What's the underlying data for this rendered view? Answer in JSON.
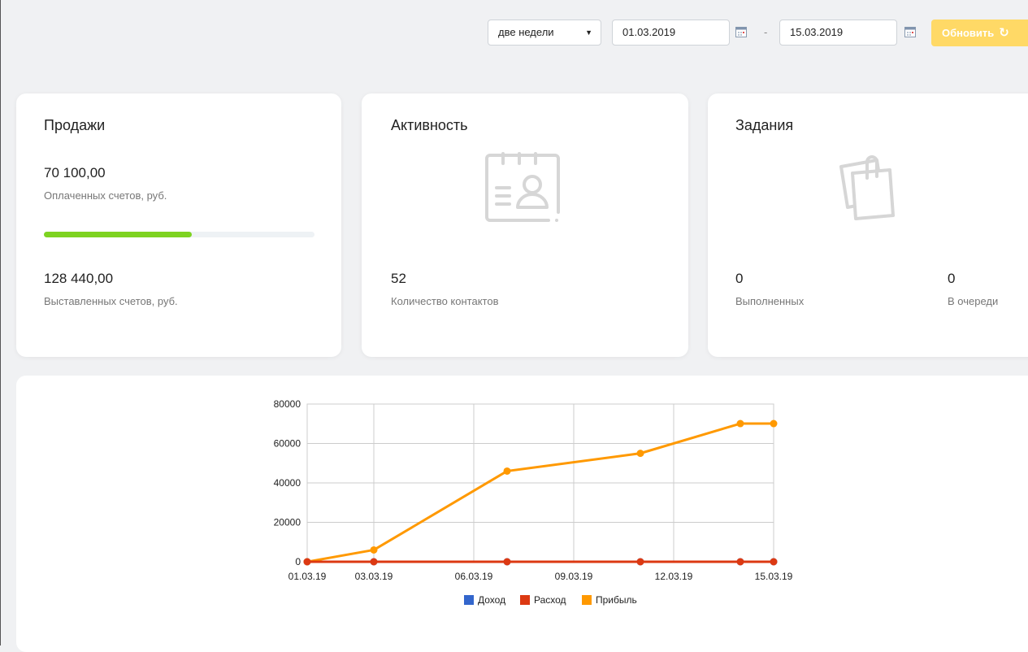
{
  "toolbar": {
    "period_select": "две недели",
    "date_from": "01.03.2019",
    "date_separator": "-",
    "date_to": "15.03.2019",
    "refresh_label": "Обновить",
    "refresh_icon": "refresh-icon",
    "accent_color": "#ffd966"
  },
  "sales": {
    "title": "Продажи",
    "paid_value": "70 100,00",
    "paid_label": "Оплаченных счетов, руб.",
    "paid_fraction": 0.546,
    "issued_value": "128 440,00",
    "issued_label": "Выставленных счетов, руб.",
    "progress_color": "#7ed321"
  },
  "activity": {
    "title": "Активность",
    "icon": "contact-card-icon",
    "contacts_value": "52",
    "contacts_label": "Количество контактов"
  },
  "tasks": {
    "title": "Задания",
    "icon": "notes-icon",
    "done_value": "0",
    "done_label": "Выполненных",
    "queue_value": "0",
    "queue_label": "В очереди"
  },
  "chart_data": {
    "type": "line",
    "x": [
      "01.03.19",
      "03.03.19",
      "07.03.19",
      "11.03.19",
      "14.03.19",
      "15.03.19"
    ],
    "x_tick_labels": [
      "01.03.19",
      "03.03.19",
      "06.03.19",
      "09.03.19",
      "12.03.19",
      "15.03.19"
    ],
    "ylim": [
      0,
      80000
    ],
    "y_ticks": [
      0,
      20000,
      40000,
      60000,
      80000
    ],
    "grid": true,
    "legend_position": "bottom",
    "series": [
      {
        "name": "Доход",
        "color": "#3366cc",
        "values": [
          0,
          0,
          0,
          0,
          0,
          0
        ]
      },
      {
        "name": "Расход",
        "color": "#dc3912",
        "values": [
          0,
          0,
          0,
          0,
          0,
          0
        ]
      },
      {
        "name": "Прибыль",
        "color": "#ff9900",
        "values": [
          0,
          6000,
          46000,
          55000,
          70100,
          70100
        ]
      }
    ]
  }
}
